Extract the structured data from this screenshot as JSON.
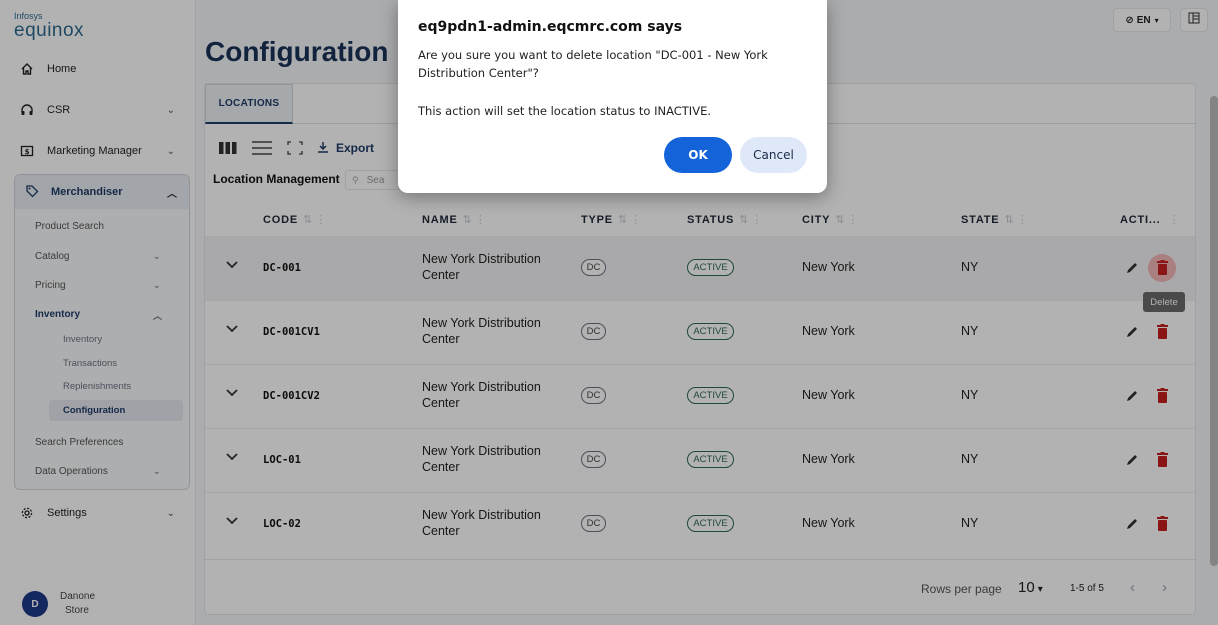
{
  "logo": {
    "line1": "Infosys",
    "line2": "equinox"
  },
  "sidebar": {
    "items": [
      {
        "label": "Home",
        "icon": "home-icon"
      },
      {
        "label": "CSR",
        "icon": "headset-icon"
      },
      {
        "label": "Marketing Manager",
        "icon": "dollar-icon"
      },
      {
        "label": "Settings",
        "icon": "gear-icon"
      }
    ],
    "merchandiser": {
      "label": "Merchandiser",
      "subitems": [
        "Product Search",
        "Catalog",
        "Pricing",
        "Inventory",
        "Search Preferences",
        "Data Operations"
      ],
      "inventory_children": [
        "Inventory",
        "Transactions",
        "Replenishments",
        "Configuration"
      ]
    }
  },
  "user": {
    "initial": "D",
    "name": "Danone",
    "role": "Store"
  },
  "header": {
    "lang": "EN"
  },
  "page": {
    "title": "Configuration"
  },
  "tabs": [
    "LOCATIONS"
  ],
  "toolbar": {
    "export_label": "Export",
    "section_label": "Location Management",
    "search_placeholder": "Sea"
  },
  "table": {
    "columns": [
      "CODE",
      "NAME",
      "TYPE",
      "STATUS",
      "CITY",
      "STATE",
      "ACTI..."
    ],
    "rows": [
      {
        "code": "DC-001",
        "name1": "New York Distribution",
        "name2": "Center",
        "type": "DC",
        "status": "ACTIVE",
        "city": "New York",
        "state": "NY"
      },
      {
        "code": "DC-001CV1",
        "name1": "New York Distribution",
        "name2": "Center",
        "type": "DC",
        "status": "ACTIVE",
        "city": "New York",
        "state": "NY"
      },
      {
        "code": "DC-001CV2",
        "name1": "New York Distribution",
        "name2": "Center",
        "type": "DC",
        "status": "ACTIVE",
        "city": "New York",
        "state": "NY"
      },
      {
        "code": "LOC-01",
        "name1": "New York Distribution",
        "name2": "Center",
        "type": "DC",
        "status": "ACTIVE",
        "city": "New York",
        "state": "NY"
      },
      {
        "code": "LOC-02",
        "name1": "New York Distribution",
        "name2": "Center",
        "type": "DC",
        "status": "ACTIVE",
        "city": "New York",
        "state": "NY"
      }
    ],
    "tooltip": "Delete"
  },
  "footer": {
    "rows_per_page_label": "Rows per page",
    "rows_per_page": "10",
    "range": "1-5 of 5"
  },
  "dialog": {
    "title": "eq9pdn1-admin.eqcmrc.com says",
    "message": "Are you sure you want to delete location \"DC-001 - New York Distribution Center\"?",
    "message2": "This action will set the location status to INACTIVE.",
    "ok": "OK",
    "cancel": "Cancel"
  },
  "colors": {
    "primary": "#1463d9",
    "brand": "#1f3b68",
    "danger": "#c81e1e",
    "active": "#2d6a4f"
  }
}
